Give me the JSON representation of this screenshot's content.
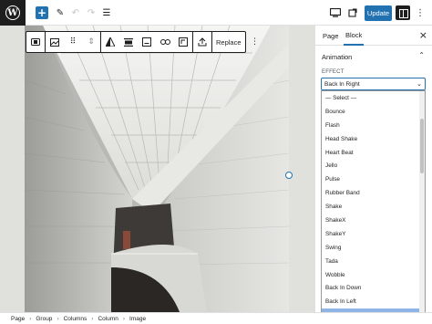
{
  "header": {
    "logo_glyph": "W",
    "add_glyph": "+",
    "update_label": "Update"
  },
  "block_toolbar": {
    "replace_label": "Replace"
  },
  "sidebar": {
    "tabs": [
      {
        "label": "Page"
      },
      {
        "label": "Block"
      }
    ],
    "active_tab": "Block",
    "section_title": "Animation",
    "effect_label": "EFFECT",
    "select_value": "Back In Right",
    "options": [
      "— Select —",
      "Bounce",
      "Flash",
      "Head Shake",
      "Heart Beat",
      "Jello",
      "Pulse",
      "Rubber Band",
      "Shake",
      "ShakeX",
      "ShakeY",
      "Swing",
      "Tada",
      "Wobble",
      "Back In Down",
      "Back In Left",
      "Back In Right"
    ],
    "selected_option": "Back In Right"
  },
  "breadcrumb": [
    "Page",
    "Group",
    "Columns",
    "Column",
    "Image"
  ],
  "colors": {
    "accent": "#2271b1",
    "dark": "#1e1e1e",
    "selected_option_bg": "#8fb5e6"
  },
  "icons": [
    "wordpress-logo-icon",
    "plus-icon",
    "pencil-icon",
    "undo-icon",
    "redo-icon",
    "list-view-icon",
    "desktop-preview-icon",
    "settings-icon",
    "more-options-icon"
  ]
}
